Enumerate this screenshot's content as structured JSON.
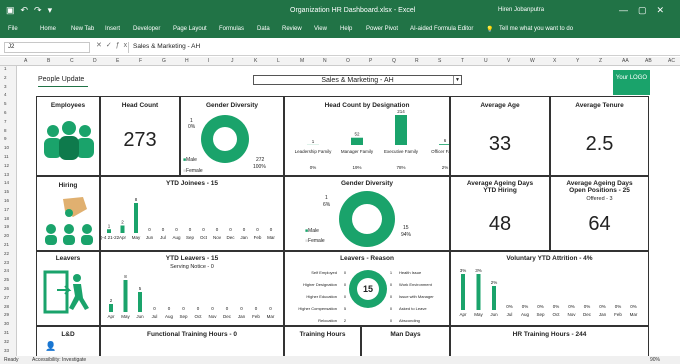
{
  "titlebar": {
    "file_name": "Organization HR Dashboard.xlsx - Excel",
    "user": "Hiren Jobanputra"
  },
  "ribbon": {
    "tabs": [
      "File",
      "Home",
      "New Tab",
      "Insert",
      "Developer",
      "Page Layout",
      "Formulas",
      "Data",
      "Review",
      "View",
      "Help",
      "Power Pivot",
      "AI-aided Formula Editor"
    ],
    "tell_me": "Tell me what you want to do"
  },
  "formula_bar": {
    "cell": "J2",
    "value": "Sales & Marketing - AH"
  },
  "columns": [
    "A",
    "B",
    "C",
    "D",
    "E",
    "F",
    "G",
    "H",
    "I",
    "J",
    "K",
    "L",
    "M",
    "N",
    "O",
    "P",
    "Q",
    "R",
    "S",
    "T",
    "U",
    "V",
    "W",
    "X",
    "Y",
    "Z",
    "AA",
    "AB",
    "AC"
  ],
  "rows": [
    "1",
    "2",
    "3",
    "4",
    "5",
    "6",
    "7",
    "8",
    "9",
    "10",
    "11",
    "12",
    "13",
    "14",
    "15",
    "16",
    "17",
    "18",
    "19",
    "20",
    "21",
    "22",
    "23",
    "24",
    "25",
    "26",
    "27",
    "28",
    "29",
    "30",
    "31",
    "32",
    "33"
  ],
  "dashboard": {
    "people_update": "People Update",
    "department": "Sales & Marketing - AH",
    "logo": "Your LOGO",
    "employees": {
      "label": "Employees"
    },
    "head_count": {
      "label": "Head Count",
      "value": "273"
    },
    "gender_diversity": {
      "label": "Gender Diversity",
      "female_count": "1",
      "female_pct": "0%",
      "male_count": "272",
      "male_pct": "100%",
      "legend_male": "Male",
      "legend_female": "Female"
    },
    "designation": {
      "label": "Head Count by Designation",
      "bars": [
        {
          "name": "Leadership Family",
          "count": "1",
          "pct": "0%",
          "value": 1
        },
        {
          "name": "Manager Family",
          "count": "52",
          "pct": "19%",
          "value": 52
        },
        {
          "name": "Executive Family",
          "count": "214",
          "pct": "78%",
          "value": 214
        },
        {
          "name": "Officer Family",
          "count": "6",
          "pct": "2%",
          "value": 6
        }
      ]
    },
    "avg_age": {
      "label": "Average Age",
      "value": "33"
    },
    "avg_tenure": {
      "label": "Average Tenure",
      "value": "2.5"
    },
    "hiring": {
      "label": "Hiring"
    },
    "ytd_joinees": {
      "label": "YTD Joinees -  15",
      "months": [
        "Q-4 21-22",
        "Apr",
        "May",
        "Jun",
        "Jul",
        "Aug",
        "Sep",
        "Oct",
        "Nov",
        "Dec",
        "Jan",
        "Feb",
        "Mar"
      ],
      "values_text": [
        "1",
        "2",
        "8",
        "0",
        "0",
        "0",
        "0",
        "0",
        "0",
        "0",
        "0",
        "0",
        "0"
      ],
      "values": [
        1,
        2,
        8,
        0,
        0,
        0,
        0,
        0,
        0,
        0,
        0,
        0,
        0
      ]
    },
    "hiring_gender": {
      "label": "Gender Diversity",
      "female_count": "1",
      "female_pct": "6%",
      "male_count": "15",
      "male_pct": "94%",
      "legend_male": "Male",
      "legend_female": "Female"
    },
    "avg_ageing_hiring": {
      "label": "Average Ageing Days YTD Hiring",
      "value": "48"
    },
    "avg_ageing_open": {
      "label": "Average Ageing Days Open Positions -  25",
      "sub": "Offered -  3",
      "value": "64"
    },
    "leavers": {
      "label": "Leavers"
    },
    "ytd_leavers": {
      "label": "YTD Leavers -  15",
      "sub": "Serving Notice -  0",
      "months": [
        "Apr",
        "May",
        "Jun",
        "Jul",
        "Aug",
        "Sep",
        "Oct",
        "Nov",
        "Dec",
        "Jan",
        "Feb",
        "Mar"
      ],
      "values_text": [
        "2",
        "8",
        "5",
        "0",
        "0",
        "0",
        "0",
        "0",
        "0",
        "0",
        "0",
        "0"
      ],
      "values": [
        2,
        8,
        5,
        0,
        0,
        0,
        0,
        0,
        0,
        0,
        0,
        0
      ]
    },
    "leavers_reason": {
      "label": "Leavers - Reason",
      "center": "15",
      "left": [
        {
          "name": "Self Employed",
          "count": "0"
        },
        {
          "name": "Higher Designation",
          "count": "0"
        },
        {
          "name": "Higher Education",
          "count": "0"
        },
        {
          "name": "Higher Compensation",
          "count": "5"
        },
        {
          "name": "Relocation",
          "count": "2"
        }
      ],
      "right": [
        {
          "name": "Health Issue",
          "count": "1"
        },
        {
          "name": "Work Environment",
          "count": "0"
        },
        {
          "name": "Issue with Manager",
          "count": "0"
        },
        {
          "name": "Asked to Leave",
          "count": "0"
        },
        {
          "name": "Absconding",
          "count": "0"
        }
      ]
    },
    "attrition": {
      "label": "Voluntary YTD Attrition -  4%",
      "months": [
        "Apr",
        "May",
        "Jun",
        "Jul",
        "Aug",
        "Sep",
        "Oct",
        "Nov",
        "Dec",
        "Jan",
        "Feb",
        "Mar"
      ],
      "values_text": [
        "3%",
        "3%",
        "2%",
        "0%",
        "0%",
        "0%",
        "0%",
        "0%",
        "0%",
        "0%",
        "0%",
        "0%"
      ],
      "values": [
        3,
        3,
        2,
        0,
        0,
        0,
        0,
        0,
        0,
        0,
        0,
        0
      ]
    },
    "ld": {
      "label": "L&D"
    },
    "functional_training": {
      "label": "Functional Training Hours -",
      "value": "0"
    },
    "training_hours": {
      "label": "Training Hours"
    },
    "man_days": {
      "label": "Man Days"
    },
    "hr_training": {
      "label": "HR Training Hours -",
      "value": "244"
    }
  },
  "status": {
    "ready": "Ready",
    "accessibility": "Accessibility: Investigate",
    "zoom": "90%"
  }
}
